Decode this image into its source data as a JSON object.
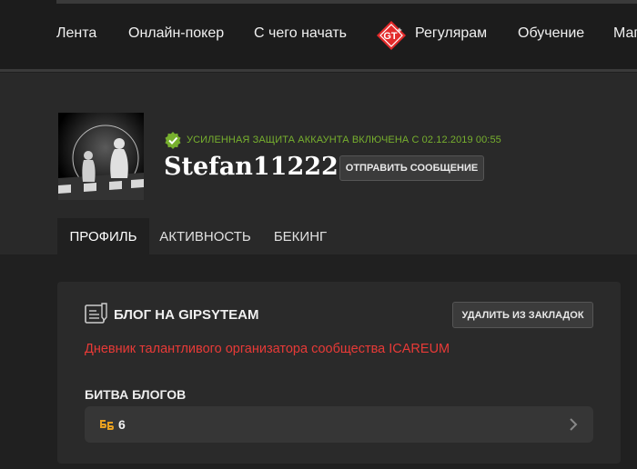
{
  "nav": {
    "items": [
      {
        "label": "Лента"
      },
      {
        "label": "Онлайн-покер"
      },
      {
        "label": "С чего начать"
      },
      {
        "label": "Регулярам",
        "icon": "gipsyteam-logo-icon"
      },
      {
        "label": "Обучение"
      },
      {
        "label": "Маг"
      }
    ]
  },
  "profile": {
    "security_status": "Усиленная защита аккаунта включена с 02.12.2019 00:55",
    "username": "Stefan11222",
    "message_button": "Отправить сообщение",
    "tabs": [
      {
        "label": "Профиль",
        "active": true
      },
      {
        "label": "Активность",
        "active": false
      },
      {
        "label": "Бекинг",
        "active": false
      }
    ]
  },
  "blog": {
    "title": "Блог на GipsyTeam",
    "bookmark_button": "Удалить из закладок",
    "description": "Дневник талантливого организатора сообщества ICAREUM",
    "battle_label": "Битва блогов",
    "battle_count": "6"
  },
  "colors": {
    "background": "#202020",
    "security_green": "#77b02e",
    "description_red": "#e83a37",
    "logo_red": "#e32b2b"
  }
}
